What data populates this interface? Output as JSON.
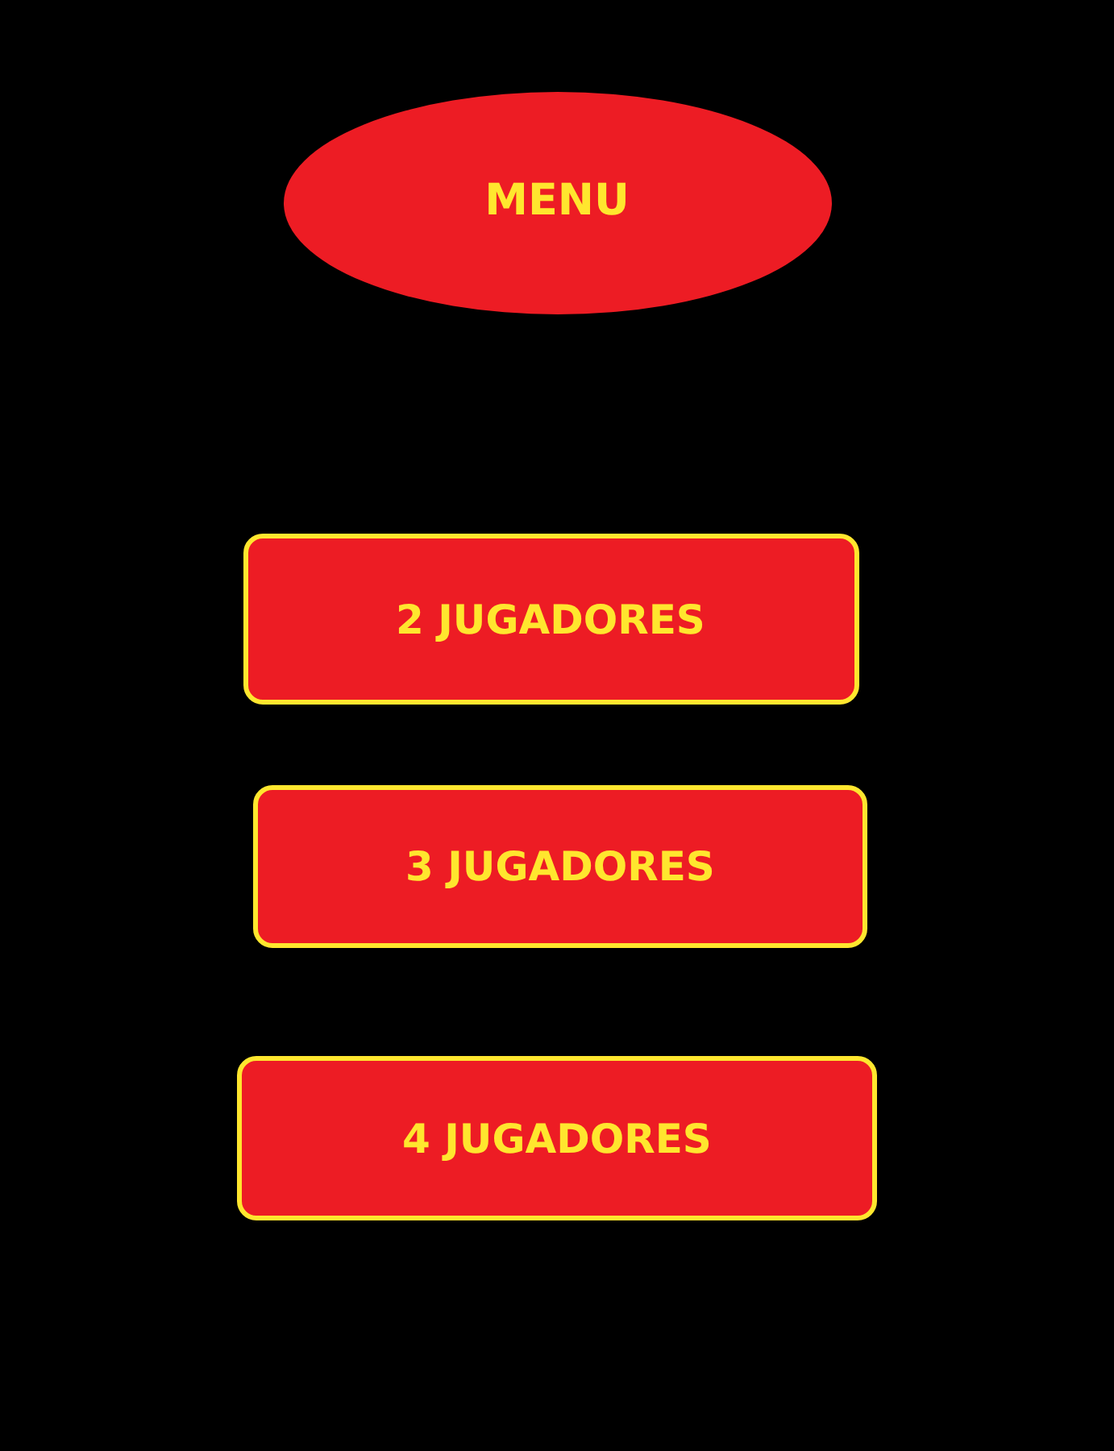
{
  "title": "MENU",
  "buttons": [
    {
      "label": "2 JUGADORES"
    },
    {
      "label": "3 JUGADORES"
    },
    {
      "label": "4 JUGADORES"
    }
  ]
}
